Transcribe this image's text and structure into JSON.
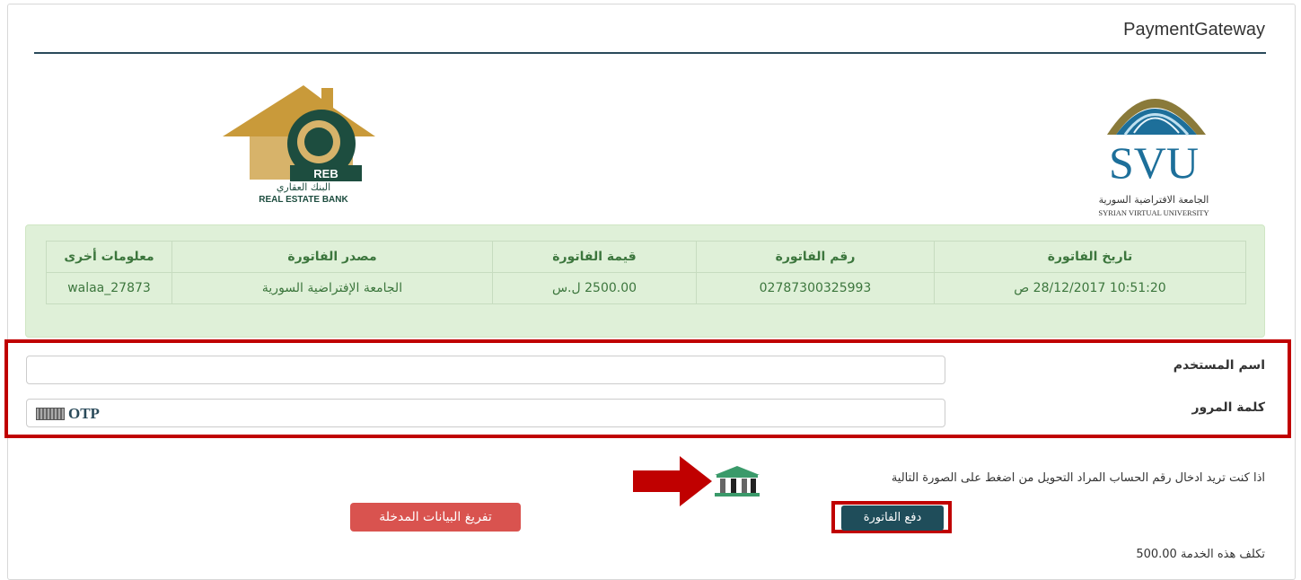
{
  "header": {
    "title": "PaymentGateway"
  },
  "logos": {
    "svu": {
      "letters": "SVU",
      "arabic": "الجامعة الافتراضية السورية",
      "english": "SYRIAN VIRTUAL UNIVERSITY"
    },
    "reb": {
      "letters": "REB",
      "arabic": "البنك العقاري",
      "english": "REAL ESTATE BANK"
    }
  },
  "invoice": {
    "columns": [
      "تاريخ الفاتورة",
      "رقم الفاتورة",
      "قيمة الفاتورة",
      "مصدر الفاتورة",
      "معلومات أخرى"
    ],
    "row": [
      "10:51:20 28/12/2017 ص",
      "02787300325993",
      "2500.00 ل.س",
      "الجامعة الإفتراضية السورية",
      "walaa_27873"
    ]
  },
  "form": {
    "username_label": "اسم المستخدم",
    "password_label": "كلمة المرور",
    "otp_label": "OTP"
  },
  "hint_text": "اذا كنت تريد ادخال رقم الحساب المراد التحويل من اضغط على الصورة التالية",
  "buttons": {
    "pay": "دفع الفاتورة",
    "clear": "تفريغ البيانات المدخلة"
  },
  "fee_text": "تكلف هذه الخدمة 500.00",
  "colors": {
    "accent": "#1f4d5a",
    "danger": "#d9534f",
    "highlight": "#c00000",
    "invoice_bg": "#dff0d8"
  }
}
